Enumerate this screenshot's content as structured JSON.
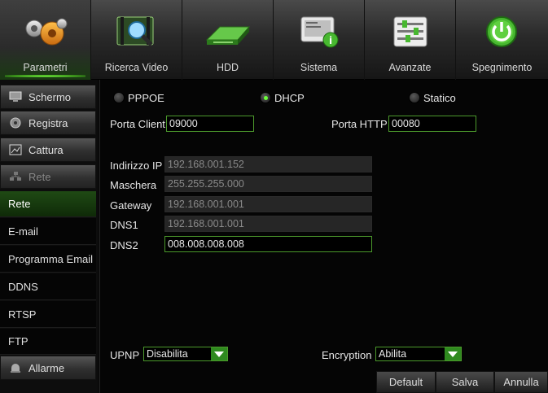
{
  "tabs": [
    {
      "label": "Parametri",
      "icon": "gears-icon",
      "active": true
    },
    {
      "label": "Ricerca Video",
      "icon": "film-search-icon",
      "active": false
    },
    {
      "label": "HDD",
      "icon": "hard-drive-icon",
      "active": false
    },
    {
      "label": "Sistema",
      "icon": "monitor-info-icon",
      "active": false
    },
    {
      "label": "Avanzate",
      "icon": "sliders-icon",
      "active": false
    },
    {
      "label": "Spegnimento",
      "icon": "power-icon",
      "active": false
    }
  ],
  "sidebar": {
    "groups": [
      {
        "label": "Schermo",
        "icon": "screen-icon"
      },
      {
        "label": "Registra",
        "icon": "record-film-icon"
      },
      {
        "label": "Cattura",
        "icon": "capture-icon"
      },
      {
        "label": "Rete",
        "icon": "network-icon"
      }
    ],
    "subitems": [
      "Rete",
      "E-mail",
      "Programma Email",
      "DDNS",
      "RTSP",
      "FTP"
    ],
    "selected": "Rete",
    "bottom_group": {
      "label": "Allarme",
      "icon": "alarm-icon"
    }
  },
  "network": {
    "modes": [
      {
        "label": "PPPOE",
        "selected": false
      },
      {
        "label": "DHCP",
        "selected": true
      },
      {
        "label": "Statico",
        "selected": false
      }
    ],
    "client_port_label": "Porta Client",
    "client_port_value": "09000",
    "http_port_label": "Porta HTTP",
    "http_port_value": "00080",
    "ip_label": "Indirizzo IP",
    "ip_value": "192.168.001.152",
    "mask_label": "Maschera",
    "mask_value": "255.255.255.000",
    "gateway_label": "Gateway",
    "gateway_value": "192.168.001.001",
    "dns1_label": "DNS1",
    "dns1_value": "192.168.001.001",
    "dns2_label": "DNS2",
    "dns2_value": "008.008.008.008",
    "upnp_label": "UPNP",
    "upnp_value": "Disabilita",
    "encryption_label": "Encryption",
    "encryption_value": "Abilita"
  },
  "buttons": {
    "default": "Default",
    "save": "Salva",
    "cancel": "Annulla"
  },
  "colors": {
    "accent_green": "#4c9a2c",
    "selected_green": "#1f4a14",
    "radio_on": "#6bff3a"
  }
}
